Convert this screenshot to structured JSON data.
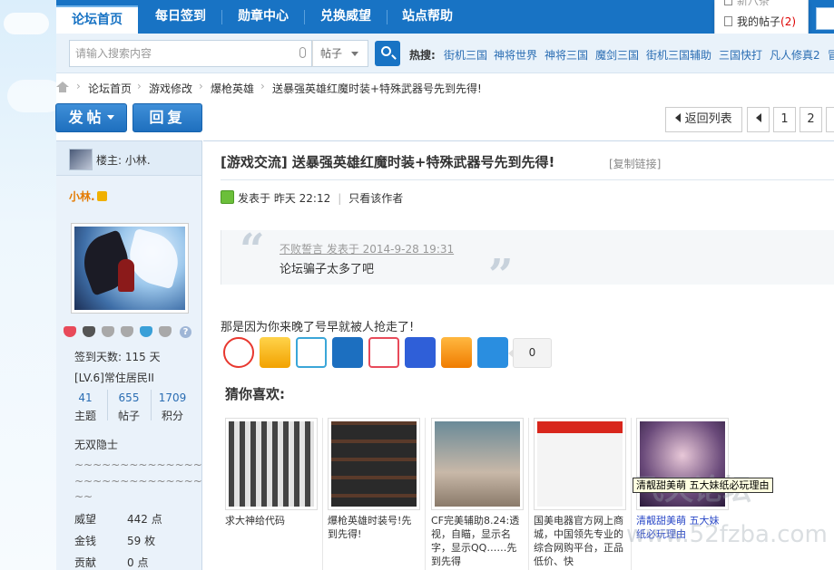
{
  "nav": {
    "tabs": [
      {
        "label": "论坛首页",
        "active": true
      },
      {
        "label": "每日签到"
      },
      {
        "label": "勋章中心"
      },
      {
        "label": "兑换威望"
      },
      {
        "label": "站点帮助"
      }
    ]
  },
  "dropdown": {
    "top_item": "新八条",
    "my_posts": "我的帖子",
    "my_posts_count": "(2)"
  },
  "search": {
    "placeholder": "请输入搜索内容",
    "type": "帖子",
    "hot_label": "热搜:",
    "hot": [
      "街机三国",
      "神将世界",
      "神将三国",
      "魔剑三国",
      "街机三国辅助",
      "三国快打",
      "凡人修真2",
      "冒"
    ]
  },
  "breadcrumb": [
    "论坛首页",
    "游戏修改",
    "爆枪英雄",
    "送暴强英雄红魔时装+特殊武器号先到先得!"
  ],
  "actions": {
    "post": "发帖",
    "reply": "回复",
    "back_to_list": "返回列表",
    "pages": [
      "1",
      "2"
    ]
  },
  "author": {
    "louzhu_label": "楼主:",
    "name": "小林.",
    "signin_label": "签到天数:",
    "signin_days": "115 天",
    "level": "[LV.6]常住居民II",
    "stats": [
      {
        "num": "41",
        "label": "主题"
      },
      {
        "num": "655",
        "label": "帖子"
      },
      {
        "num": "1709",
        "label": "积分"
      }
    ],
    "motto": "无双隐士",
    "tilde1": "~~~~~~~~~~~~~~~~~~",
    "tilde2": "~~~~~~~~~~~~~~~~~~",
    "tilde3": "~~",
    "kv": [
      {
        "k": "威望",
        "v": "442 点"
      },
      {
        "k": "金钱",
        "v": "59 枚"
      },
      {
        "k": "贡献",
        "v": "0 点"
      }
    ]
  },
  "post": {
    "title": "[游戏交流] 送暴强英雄红魔时装+特殊武器号先到先得!",
    "copy_link": "[复制链接]",
    "posted_label": "发表于",
    "posted_time": "昨天 22:12",
    "only_author": "只看该作者",
    "quote_author": "不败誓言 发表于 2014-9-28 19:31",
    "quote_text": "论坛骗子太多了吧",
    "body": "那是因为你来晚了号早就被人抢走了!",
    "share_count": "0",
    "share_icons": [
      "weibo-icon",
      "qzone-icon",
      "tencent-weibo-icon",
      "renren-icon",
      "kaixin-icon",
      "baidu-icon",
      "qq-icon",
      "more-icon"
    ]
  },
  "guess": {
    "title": "猜你喜欢:",
    "items": [
      {
        "caption": "求大神给代码"
      },
      {
        "caption": "爆枪英雄时装号!先到先得!"
      },
      {
        "caption": "CF完美辅助8.24:透视，自瞄，显示名字，显示QQ……先到先得"
      },
      {
        "caption": "国美电器官方网上商城，中国领先专业的综合网购平台，正品低价、快"
      },
      {
        "caption": "清靓甜美萌 五大妹纸必玩理由"
      }
    ]
  },
  "tooltip": "清靓甜美萌 五大妹纸必玩理由",
  "watermark": {
    "line1": "飞天论坛",
    "line2": "www.52fzba.com"
  },
  "colors": {
    "brand": "#1873c4",
    "link": "#2a6db3",
    "orange": "#e47a00"
  }
}
